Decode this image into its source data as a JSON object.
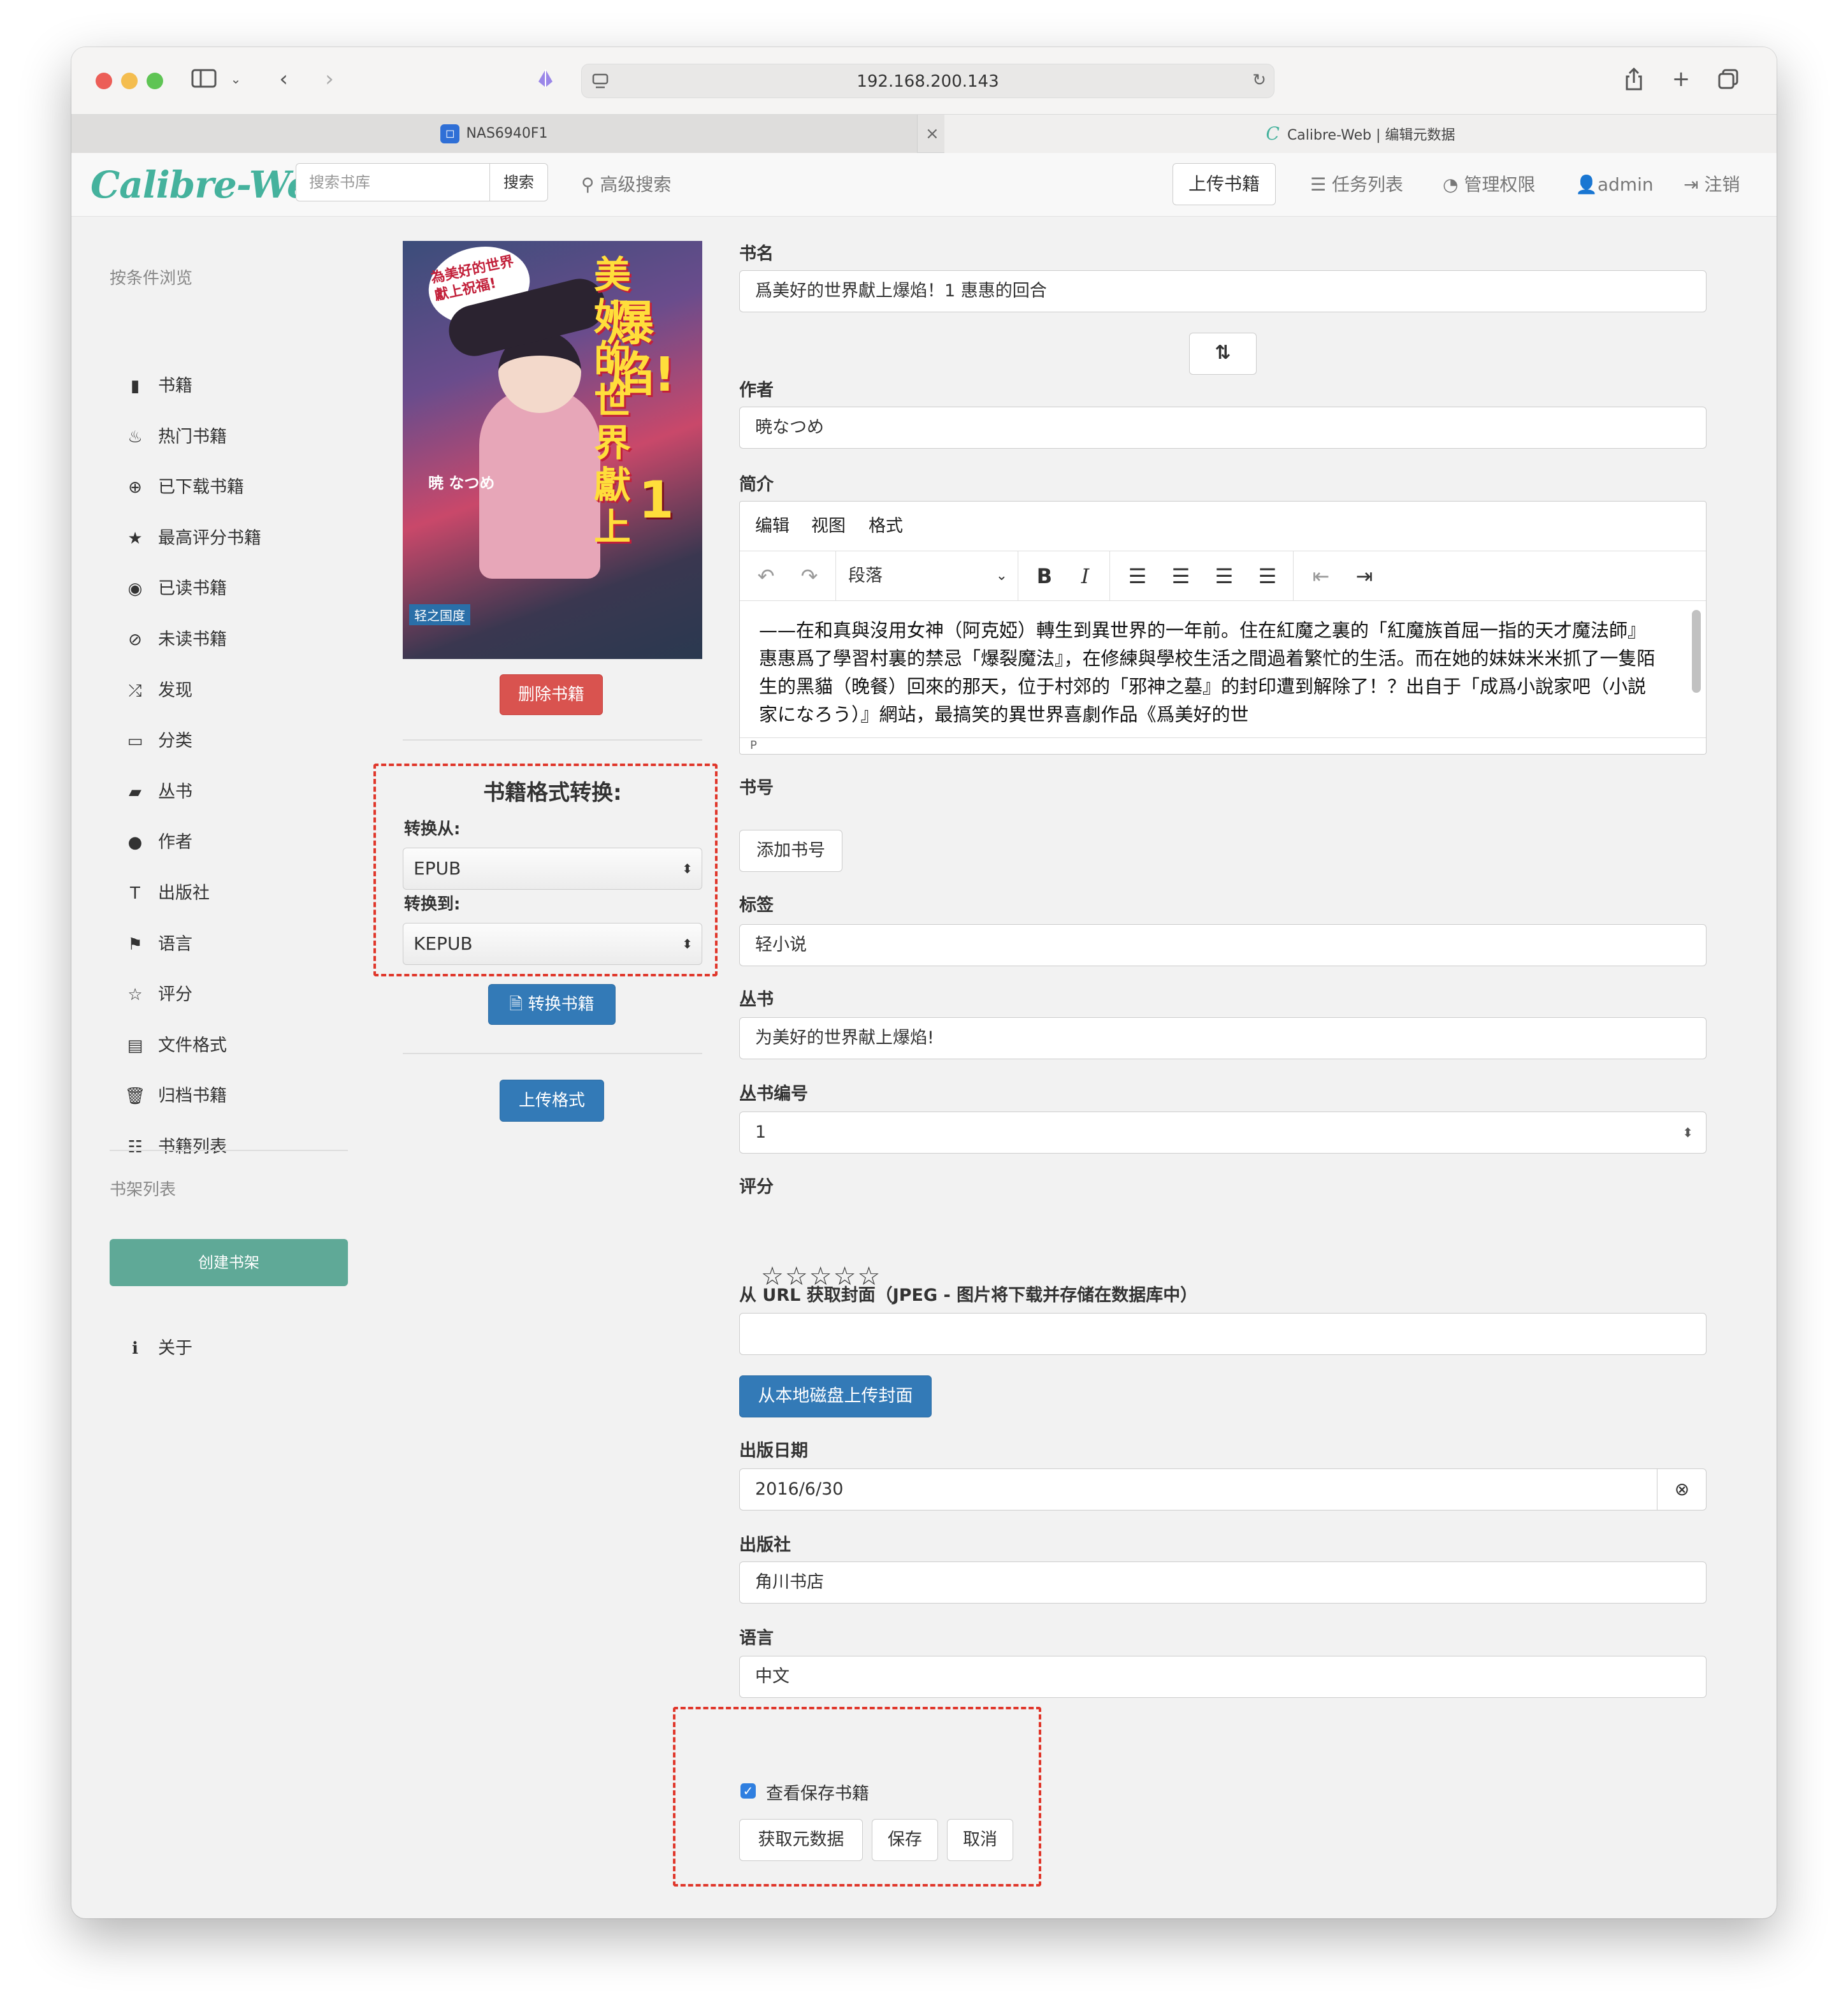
{
  "browser": {
    "url": "192.168.200.143",
    "tabs": [
      {
        "label": "NAS6940F1"
      },
      {
        "label": "Calibre-Web | 编辑元数据"
      }
    ]
  },
  "navbar": {
    "logo": "Calibre-Web",
    "search_placeholder": "搜索书库",
    "search_button": "搜索",
    "advanced_search": "高级搜索",
    "upload": "上传书籍",
    "tasks": "任务列表",
    "admin_settings": "管理权限",
    "user": "admin",
    "logout": "注销"
  },
  "sidebar": {
    "browse_heading": "按条件浏览",
    "items": [
      {
        "label": "书籍",
        "icon": "book-icon"
      },
      {
        "label": "热门书籍",
        "icon": "fire-icon"
      },
      {
        "label": "已下载书籍",
        "icon": "download-icon"
      },
      {
        "label": "最高评分书籍",
        "icon": "star-icon"
      },
      {
        "label": "已读书籍",
        "icon": "eye-icon"
      },
      {
        "label": "未读书籍",
        "icon": "eye-slash-icon"
      },
      {
        "label": "发现",
        "icon": "random-icon"
      },
      {
        "label": "分类",
        "icon": "inbox-icon"
      },
      {
        "label": "丛书",
        "icon": "bookmark-icon"
      },
      {
        "label": "作者",
        "icon": "user-icon"
      },
      {
        "label": "出版社",
        "icon": "text-size-icon"
      },
      {
        "label": "语言",
        "icon": "flag-icon"
      },
      {
        "label": "评分",
        "icon": "star-empty-icon"
      },
      {
        "label": "文件格式",
        "icon": "file-icon"
      },
      {
        "label": "归档书籍",
        "icon": "trash-icon"
      },
      {
        "label": "书籍列表",
        "icon": "list-icon"
      }
    ],
    "shelves_heading": "书架列表",
    "create_shelf": "创建书架",
    "about": "关于"
  },
  "left_panel": {
    "delete_book": "删除书籍",
    "convert_title": "书籍格式转换:",
    "convert_from_label": "转换从:",
    "convert_from_value": "EPUB",
    "convert_to_label": "转换到:",
    "convert_to_value": "KEPUB",
    "convert_button": "转换书籍",
    "upload_format": "上传格式"
  },
  "form": {
    "title_label": "书名",
    "title_value": "爲美好的世界獻上爆焰！1 惠惠的回合",
    "author_label": "作者",
    "author_value": "暁なつめ",
    "description_label": "简介",
    "editor_menu": [
      "编辑",
      "视图",
      "格式"
    ],
    "editor_block_format": "段落",
    "editor_statusbar": "P",
    "description_text": "——在和真與沒用女神（阿克婭）轉生到異世界的一年前。住在紅魔之裏的「紅魔族首屈一指的天才魔法師』惠惠爲了學習村裏的禁忌「爆裂魔法』，在修練與學校生活之間過着繁忙的生活。而在她的妹妹米米抓了一隻陌生的黑貓（晚餐）回來的那天，位于村郊的「邪神之墓』的封印遭到解除了！？出自于「成爲小說家吧（小説家になろう）』網站，最搞笑的異世界喜劇作品《爲美好的世",
    "identifiers_label": "书号",
    "add_identifier": "添加书号",
    "tags_label": "标签",
    "tags_value": "轻小说",
    "series_label": "丛书",
    "series_value": "为美好的世界献上爆焰!",
    "series_index_label": "丛书编号",
    "series_index_value": "1",
    "rating_label": "评分",
    "rating_value": 0,
    "rating_stars": "☆☆☆☆☆",
    "cover_url_label": "从 URL 获取封面（JPEG - 图片将下载并存储在数据库中）",
    "cover_url_value": "",
    "upload_cover": "从本地磁盘上传封面",
    "pubdate_label": "出版日期",
    "pubdate_value": "2016/6/30",
    "publisher_label": "出版社",
    "publisher_value": "角川书店",
    "language_label": "语言",
    "language_value": "中文",
    "view_after_save": "查看保存书籍",
    "view_after_save_checked": true,
    "fetch_metadata": "获取元数据",
    "save": "保存",
    "cancel": "取消"
  },
  "cover_text": {
    "title_top": "為美好的世界獻上祝福!",
    "title_main": "爆焰!",
    "title_side": "美好的世界獻上",
    "volume": "1",
    "author": "暁 なつめ",
    "publisher": "轻之国度"
  },
  "colors": {
    "accent": "#45b29d",
    "danger": "#d9534f",
    "primary": "#337ab7",
    "highlight_box": "#e0372b"
  }
}
